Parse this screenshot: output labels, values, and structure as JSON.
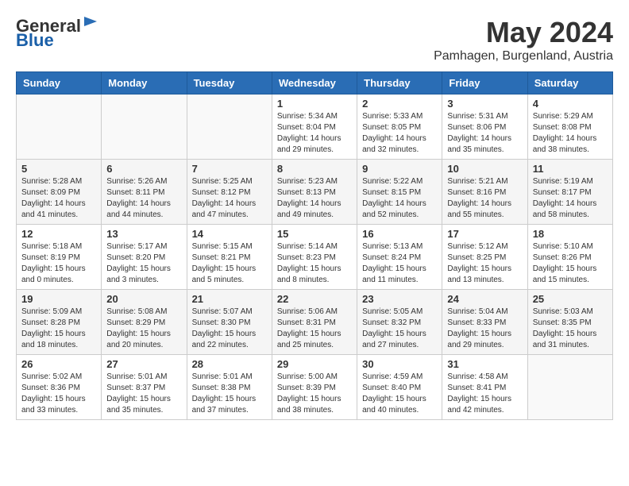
{
  "header": {
    "logo_general": "General",
    "logo_blue": "Blue",
    "month": "May 2024",
    "location": "Pamhagen, Burgenland, Austria"
  },
  "weekdays": [
    "Sunday",
    "Monday",
    "Tuesday",
    "Wednesday",
    "Thursday",
    "Friday",
    "Saturday"
  ],
  "weeks": [
    [
      {
        "day": "",
        "content": ""
      },
      {
        "day": "",
        "content": ""
      },
      {
        "day": "",
        "content": ""
      },
      {
        "day": "1",
        "content": "Sunrise: 5:34 AM\nSunset: 8:04 PM\nDaylight: 14 hours\nand 29 minutes."
      },
      {
        "day": "2",
        "content": "Sunrise: 5:33 AM\nSunset: 8:05 PM\nDaylight: 14 hours\nand 32 minutes."
      },
      {
        "day": "3",
        "content": "Sunrise: 5:31 AM\nSunset: 8:06 PM\nDaylight: 14 hours\nand 35 minutes."
      },
      {
        "day": "4",
        "content": "Sunrise: 5:29 AM\nSunset: 8:08 PM\nDaylight: 14 hours\nand 38 minutes."
      }
    ],
    [
      {
        "day": "5",
        "content": "Sunrise: 5:28 AM\nSunset: 8:09 PM\nDaylight: 14 hours\nand 41 minutes."
      },
      {
        "day": "6",
        "content": "Sunrise: 5:26 AM\nSunset: 8:11 PM\nDaylight: 14 hours\nand 44 minutes."
      },
      {
        "day": "7",
        "content": "Sunrise: 5:25 AM\nSunset: 8:12 PM\nDaylight: 14 hours\nand 47 minutes."
      },
      {
        "day": "8",
        "content": "Sunrise: 5:23 AM\nSunset: 8:13 PM\nDaylight: 14 hours\nand 49 minutes."
      },
      {
        "day": "9",
        "content": "Sunrise: 5:22 AM\nSunset: 8:15 PM\nDaylight: 14 hours\nand 52 minutes."
      },
      {
        "day": "10",
        "content": "Sunrise: 5:21 AM\nSunset: 8:16 PM\nDaylight: 14 hours\nand 55 minutes."
      },
      {
        "day": "11",
        "content": "Sunrise: 5:19 AM\nSunset: 8:17 PM\nDaylight: 14 hours\nand 58 minutes."
      }
    ],
    [
      {
        "day": "12",
        "content": "Sunrise: 5:18 AM\nSunset: 8:19 PM\nDaylight: 15 hours\nand 0 minutes."
      },
      {
        "day": "13",
        "content": "Sunrise: 5:17 AM\nSunset: 8:20 PM\nDaylight: 15 hours\nand 3 minutes."
      },
      {
        "day": "14",
        "content": "Sunrise: 5:15 AM\nSunset: 8:21 PM\nDaylight: 15 hours\nand 5 minutes."
      },
      {
        "day": "15",
        "content": "Sunrise: 5:14 AM\nSunset: 8:23 PM\nDaylight: 15 hours\nand 8 minutes."
      },
      {
        "day": "16",
        "content": "Sunrise: 5:13 AM\nSunset: 8:24 PM\nDaylight: 15 hours\nand 11 minutes."
      },
      {
        "day": "17",
        "content": "Sunrise: 5:12 AM\nSunset: 8:25 PM\nDaylight: 15 hours\nand 13 minutes."
      },
      {
        "day": "18",
        "content": "Sunrise: 5:10 AM\nSunset: 8:26 PM\nDaylight: 15 hours\nand 15 minutes."
      }
    ],
    [
      {
        "day": "19",
        "content": "Sunrise: 5:09 AM\nSunset: 8:28 PM\nDaylight: 15 hours\nand 18 minutes."
      },
      {
        "day": "20",
        "content": "Sunrise: 5:08 AM\nSunset: 8:29 PM\nDaylight: 15 hours\nand 20 minutes."
      },
      {
        "day": "21",
        "content": "Sunrise: 5:07 AM\nSunset: 8:30 PM\nDaylight: 15 hours\nand 22 minutes."
      },
      {
        "day": "22",
        "content": "Sunrise: 5:06 AM\nSunset: 8:31 PM\nDaylight: 15 hours\nand 25 minutes."
      },
      {
        "day": "23",
        "content": "Sunrise: 5:05 AM\nSunset: 8:32 PM\nDaylight: 15 hours\nand 27 minutes."
      },
      {
        "day": "24",
        "content": "Sunrise: 5:04 AM\nSunset: 8:33 PM\nDaylight: 15 hours\nand 29 minutes."
      },
      {
        "day": "25",
        "content": "Sunrise: 5:03 AM\nSunset: 8:35 PM\nDaylight: 15 hours\nand 31 minutes."
      }
    ],
    [
      {
        "day": "26",
        "content": "Sunrise: 5:02 AM\nSunset: 8:36 PM\nDaylight: 15 hours\nand 33 minutes."
      },
      {
        "day": "27",
        "content": "Sunrise: 5:01 AM\nSunset: 8:37 PM\nDaylight: 15 hours\nand 35 minutes."
      },
      {
        "day": "28",
        "content": "Sunrise: 5:01 AM\nSunset: 8:38 PM\nDaylight: 15 hours\nand 37 minutes."
      },
      {
        "day": "29",
        "content": "Sunrise: 5:00 AM\nSunset: 8:39 PM\nDaylight: 15 hours\nand 38 minutes."
      },
      {
        "day": "30",
        "content": "Sunrise: 4:59 AM\nSunset: 8:40 PM\nDaylight: 15 hours\nand 40 minutes."
      },
      {
        "day": "31",
        "content": "Sunrise: 4:58 AM\nSunset: 8:41 PM\nDaylight: 15 hours\nand 42 minutes."
      },
      {
        "day": "",
        "content": ""
      }
    ]
  ]
}
